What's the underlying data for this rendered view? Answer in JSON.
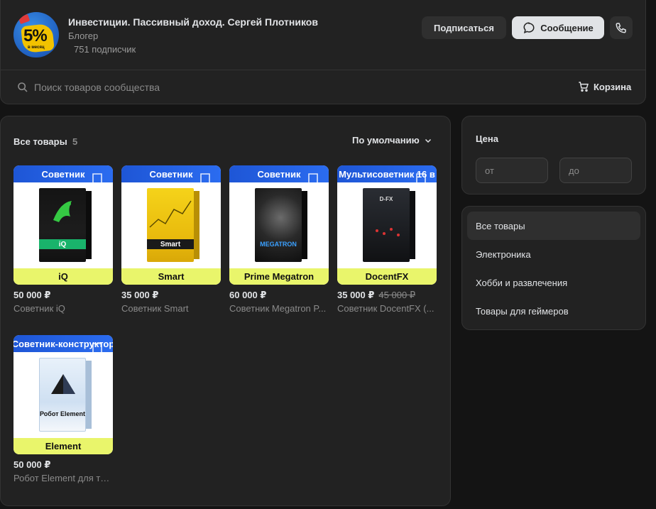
{
  "header": {
    "group_title": "Инвестиции. Пассивный доход. Сергей Плотников",
    "status": "Блогер",
    "subscribers": "751 подписчик",
    "avatar_text": "5%",
    "avatar_subtext": "в месяц",
    "subscribe_label": "Подписаться",
    "message_label": "Сообщение"
  },
  "search": {
    "placeholder": "Поиск товаров сообщества"
  },
  "cart": {
    "label": "Корзина"
  },
  "products_section": {
    "title": "Все товары",
    "count": "5",
    "sort_label": "По умолчанию"
  },
  "products": [
    {
      "banner": "Советник",
      "label": "iQ",
      "box_text": "iQ",
      "price": "50 000 ₽",
      "old_price": "",
      "name": "Советник iQ"
    },
    {
      "banner": "Советник",
      "label": "Smart",
      "box_text": "Smart",
      "price": "35 000 ₽",
      "old_price": "",
      "name": "Советник Smart"
    },
    {
      "banner": "Советник",
      "label": "Prime Megatron",
      "box_text": "MEGATRON",
      "price": "60 000 ₽",
      "old_price": "",
      "name": "Советник Megatron P..."
    },
    {
      "banner": "Мультисоветник 16 в",
      "label": "DocentFX",
      "box_text": "D-FX",
      "price": "35 000 ₽",
      "old_price": "45 000 ₽",
      "name": "Советник DocentFX (..."
    },
    {
      "banner": "Советник-конструктор",
      "label": "Element",
      "box_text": "Робот Element",
      "price": "50 000 ₽",
      "old_price": "",
      "name": "Робот Element для то..."
    }
  ],
  "price_filter": {
    "title": "Цена",
    "from_placeholder": "от",
    "to_placeholder": "до"
  },
  "categories": [
    {
      "label": "Все товары",
      "active": true
    },
    {
      "label": "Электроника",
      "active": false
    },
    {
      "label": "Хобби и развлечения",
      "active": false
    },
    {
      "label": "Товары для геймеров",
      "active": false
    }
  ],
  "colors": {
    "page_bg": "#141414",
    "card_bg": "#222222",
    "banner_blue": "#2b6cf0",
    "banner_yellow": "#e9f56b",
    "text_primary": "#e1e3e6",
    "text_secondary": "#8a8a8a"
  },
  "icons": {
    "search": "search-icon",
    "cart": "cart-icon",
    "message": "message-bubble-icon",
    "call": "phone-icon",
    "sort": "chevron-down-icon",
    "bookmark": "bookmark-icon"
  }
}
